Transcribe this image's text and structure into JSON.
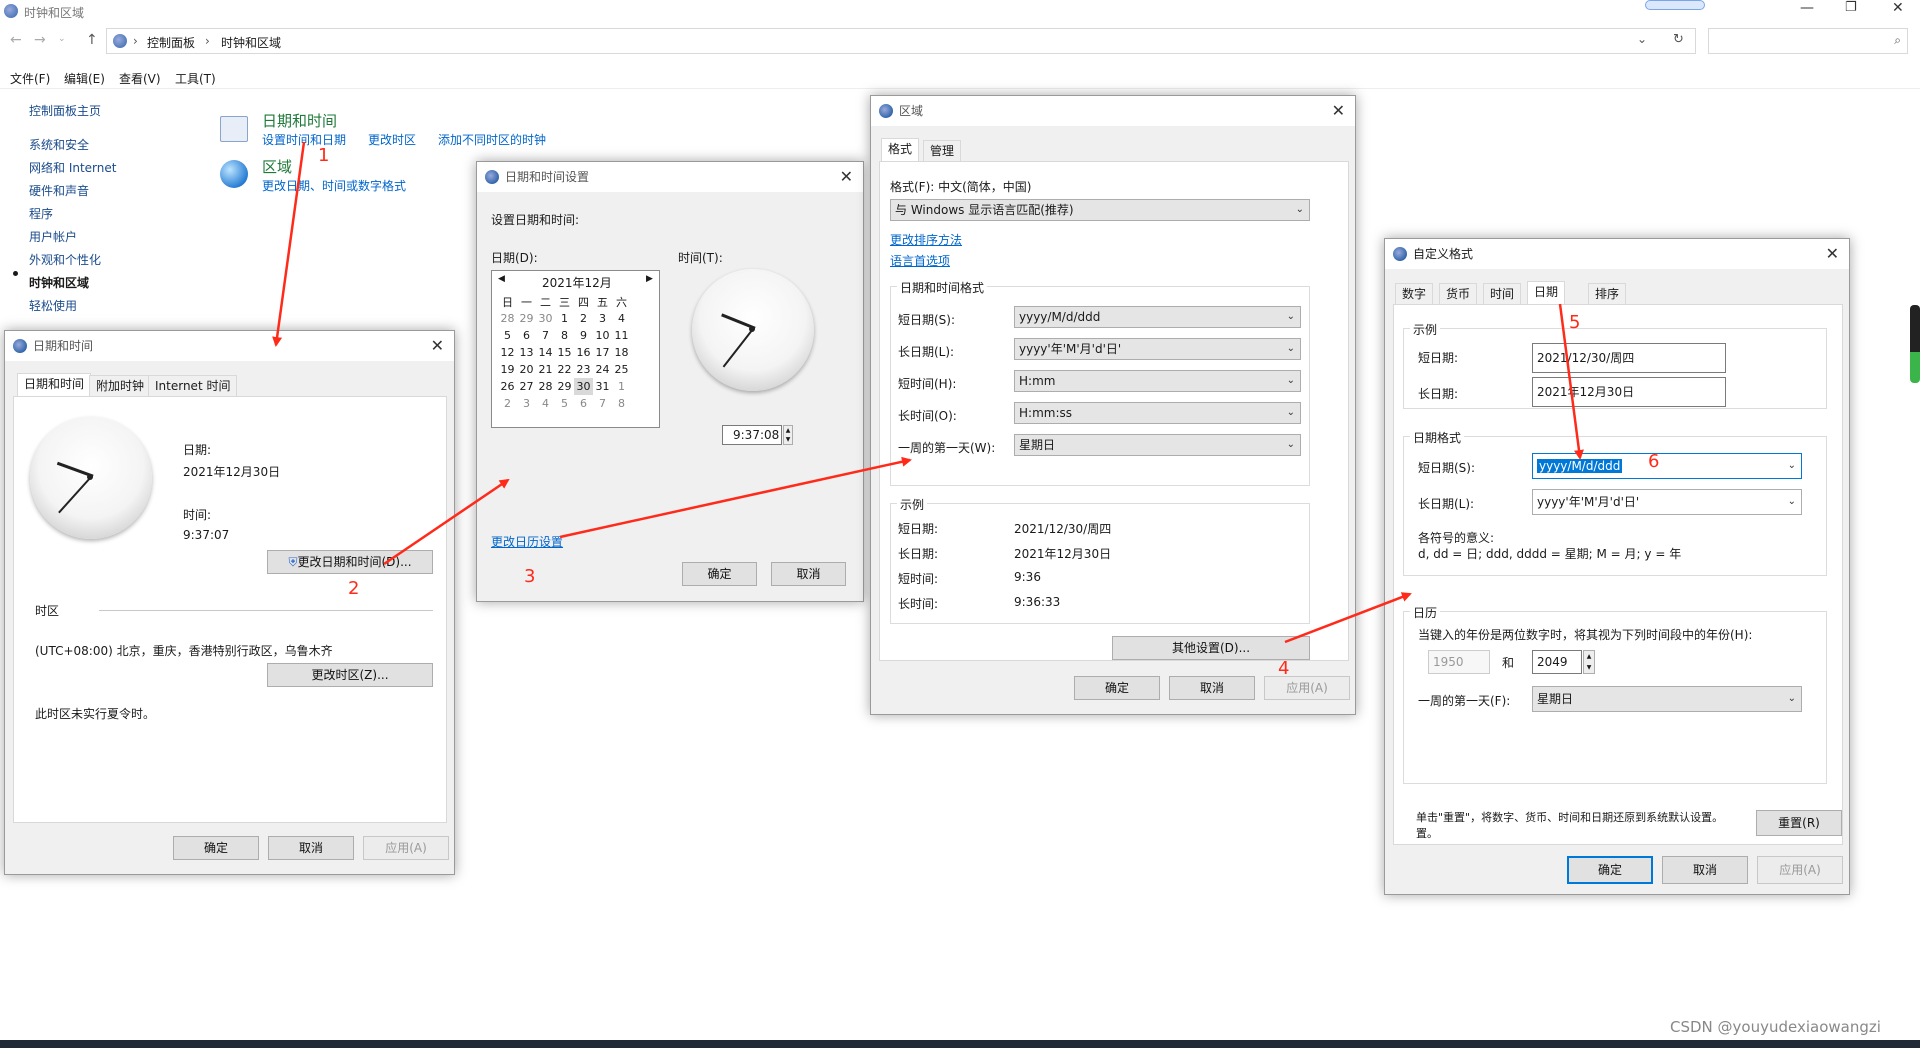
{
  "window": {
    "title": "时钟和区域"
  },
  "address": {
    "path": [
      "控制面板",
      "时钟和区域"
    ]
  },
  "menu": [
    "文件(F)",
    "编辑(E)",
    "查看(V)",
    "工具(T)"
  ],
  "sidebar": {
    "items": [
      "控制面板主页",
      "系统和安全",
      "网络和 Internet",
      "硬件和声音",
      "程序",
      "用户帐户",
      "外观和个性化",
      "时钟和区域",
      "轻松使用"
    ],
    "active": "时钟和区域"
  },
  "categories": {
    "datetime": {
      "title": "日期和时间",
      "links": [
        "设置时间和日期",
        "更改时区",
        "添加不同时区的时钟"
      ]
    },
    "region": {
      "title": "区域",
      "links": [
        "更改日期、时间或数字格式"
      ]
    }
  },
  "dlg_datetime": {
    "title": "日期和时间",
    "tabs": [
      "日期和时间",
      "附加时钟",
      "Internet 时间"
    ],
    "date_label": "日期:",
    "date_value": "2021年12月30日",
    "time_label": "时间:",
    "time_value": "9:37:07",
    "change_btn": "更改日期和时间(D)...",
    "tz_section": "时区",
    "tz_value": "(UTC+08:00) 北京，重庆，香港特别行政区，乌鲁木齐",
    "change_tz_btn": "更改时区(Z)...",
    "dst_note": "此时区未实行夏令时。",
    "ok": "确定",
    "cancel": "取消",
    "apply": "应用(A)"
  },
  "dlg_settings": {
    "title": "日期和时间设置",
    "heading": "设置日期和时间:",
    "date_label": "日期(D):",
    "time_label": "时间(T):",
    "month": "2021年12月",
    "weekdays": [
      "日",
      "一",
      "二",
      "三",
      "四",
      "五",
      "六"
    ],
    "weeks": [
      [
        "28",
        "29",
        "30",
        "1",
        "2",
        "3",
        "4"
      ],
      [
        "5",
        "6",
        "7",
        "8",
        "9",
        "10",
        "11"
      ],
      [
        "12",
        "13",
        "14",
        "15",
        "16",
        "17",
        "18"
      ],
      [
        "19",
        "20",
        "21",
        "22",
        "23",
        "24",
        "25"
      ],
      [
        "26",
        "27",
        "28",
        "29",
        "30",
        "31",
        "1"
      ],
      [
        "2",
        "3",
        "4",
        "5",
        "6",
        "7",
        "8"
      ]
    ],
    "selected_day": "30",
    "time_value": "9:37:08",
    "calendar_link": "更改日历设置",
    "ok": "确定",
    "cancel": "取消"
  },
  "dlg_region": {
    "title": "区域",
    "tabs": [
      "格式",
      "管理"
    ],
    "format_label": "格式(F): 中文(简体，中国)",
    "format_value": "与 Windows 显示语言匹配(推荐)",
    "link_sort": "更改排序方法",
    "link_lang": "语言首选项",
    "group_formats": "日期和时间格式",
    "rows": [
      {
        "label": "短日期(S):",
        "value": "yyyy/M/d/ddd"
      },
      {
        "label": "长日期(L):",
        "value": "yyyy'年'M'月'd'日'"
      },
      {
        "label": "短时间(H):",
        "value": "H:mm"
      },
      {
        "label": "长时间(O):",
        "value": "H:mm:ss"
      },
      {
        "label": "一周的第一天(W):",
        "value": "星期日"
      }
    ],
    "group_example": "示例",
    "examples": [
      {
        "label": "短日期:",
        "value": "2021/12/30/周四"
      },
      {
        "label": "长日期:",
        "value": "2021年12月30日"
      },
      {
        "label": "短时间:",
        "value": "9:36"
      },
      {
        "label": "长时间:",
        "value": "9:36:33"
      }
    ],
    "other_btn": "其他设置(D)...",
    "ok": "确定",
    "cancel": "取消",
    "apply": "应用(A)"
  },
  "dlg_custom": {
    "title": "自定义格式",
    "tabs": [
      "数字",
      "货币",
      "时间",
      "日期",
      "排序"
    ],
    "group_example": "示例",
    "ex_short_label": "短日期:",
    "ex_short_value": "2021/12/30/周四",
    "ex_long_label": "长日期:",
    "ex_long_value": "2021年12月30日",
    "group_format": "日期格式",
    "short_label": "短日期(S):",
    "short_value": "yyyy/M/d/ddd",
    "long_label": "长日期(L):",
    "long_value": "yyyy'年'M'月'd'日'",
    "meaning_title": "各符号的意义:",
    "meaning": "d, dd = 日;  ddd, dddd = 星期;  M = 月;  y = 年",
    "group_calendar": "日历",
    "calendar_desc": "当键入的年份是两位数字时，将其视为下列时间段中的年份(H):",
    "year_from": "1950",
    "and": "和",
    "year_to": "2049",
    "first_day_label": "一周的第一天(F):",
    "first_day_value": "星期日",
    "reset_desc_1": "单击\"重置\"，将数字、货币、时间和日期还原到系统默认设置。",
    "reset_desc_2": "置。",
    "reset_btn": "重置(R)",
    "ok": "确定",
    "cancel": "取消",
    "apply": "应用(A)"
  },
  "annotations": [
    "1",
    "2",
    "3",
    "4",
    "5",
    "6"
  ],
  "watermark": "CSDN @youyudexiaowangzi",
  "colors": {
    "accent": "#0078d7",
    "link": "#0066cc",
    "annotation": "#ff2a1a",
    "title_green": "#1f7a3a"
  }
}
